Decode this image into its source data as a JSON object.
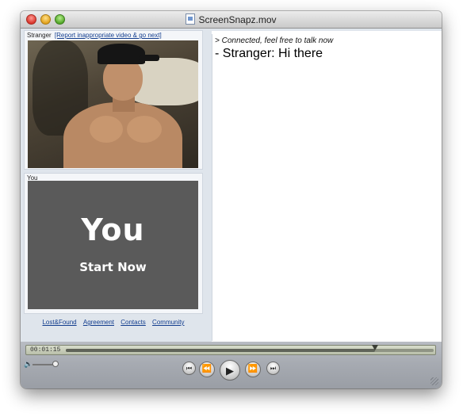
{
  "window": {
    "title": "ScreenSnapz.mov"
  },
  "stranger_panel": {
    "label": "Stranger",
    "report_link": "[Report inappropriate video & go next]"
  },
  "you_panel": {
    "label": "You",
    "big_text": "You",
    "small_text": "Start Now"
  },
  "footer_links": [
    "Lost&Found",
    "Agreement",
    "Contacts",
    "Community"
  ],
  "chat": {
    "system_message": "> Connected, feel free to talk now",
    "messages": [
      "- Stranger: Hi there"
    ]
  },
  "player": {
    "time": "00:01:15",
    "progress": 0.84,
    "volume": 0.8
  }
}
